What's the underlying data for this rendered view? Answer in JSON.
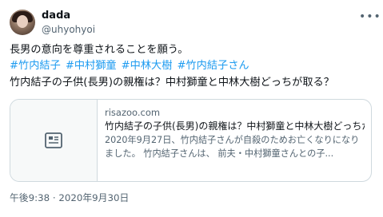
{
  "author": {
    "name": "dada",
    "handle": "@uhyohyoi"
  },
  "more_icon": "more-horizontal-icon",
  "tweet": {
    "line1": "長男の意向を尊重されることを願う。",
    "hashtags": [
      "#竹内結子",
      "#中村獅童",
      "#中林大樹",
      "#竹内結子さん"
    ],
    "line3": "竹内結子の子供(長男)の親権は？中村獅童と中林大樹どっちが取る？"
  },
  "card": {
    "thumbnail_icon": "article-icon",
    "domain": "risazoo.com",
    "title": "竹内結子の子供(長男)の親権は？中村獅童と中林大樹どっちが取る？",
    "description": "2020年9月27日、竹内結子さんが自殺のためお亡くなりになりました。 竹内結子さんは、 前夫・中村獅童さんとの子..."
  },
  "timestamp": "午後9:38 · 2020年9月30日"
}
